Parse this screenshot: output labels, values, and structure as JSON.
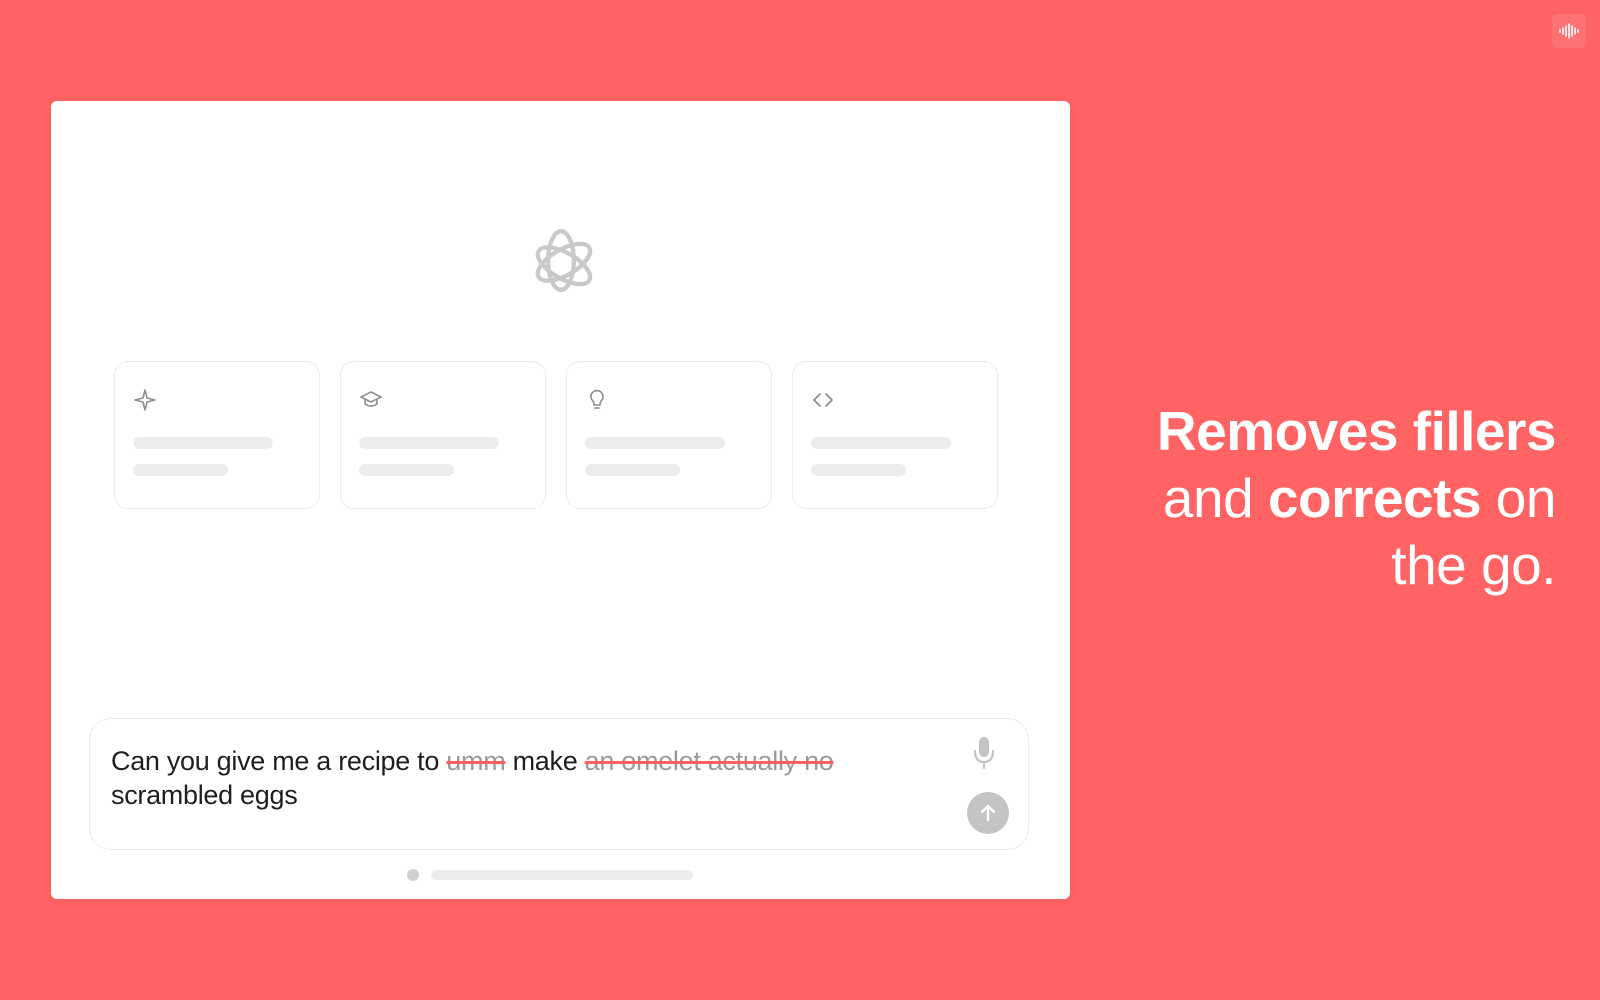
{
  "colors": {
    "background": "#ff6363",
    "strike": "#ff5f5f",
    "send_button": "#c4c4c6"
  },
  "corner_badge": {
    "icon": "sound-wave-icon"
  },
  "app": {
    "logo_icon": "openai-logo-icon",
    "cards": [
      {
        "icon": "sparkle-icon"
      },
      {
        "icon": "graduation-cap-icon"
      },
      {
        "icon": "lightbulb-icon"
      },
      {
        "icon": "code-brackets-icon"
      }
    ],
    "composer": {
      "text_parts": [
        {
          "text": "Can you give me a recipe to ",
          "struck": false
        },
        {
          "text": "umm",
          "struck": true
        },
        {
          "text": " make ",
          "struck": false
        },
        {
          "text": "an omelet actually no",
          "struck": true
        },
        {
          "text": " scrambled eggs",
          "struck": false
        }
      ],
      "mic_icon": "microphone-icon",
      "send_icon": "arrow-up-icon"
    }
  },
  "headline": {
    "line1_bold": "Removes fillers",
    "line2_light_a": "and ",
    "line2_bold": "corrects",
    "line2_light_b": " on",
    "line3_light": "the go."
  }
}
